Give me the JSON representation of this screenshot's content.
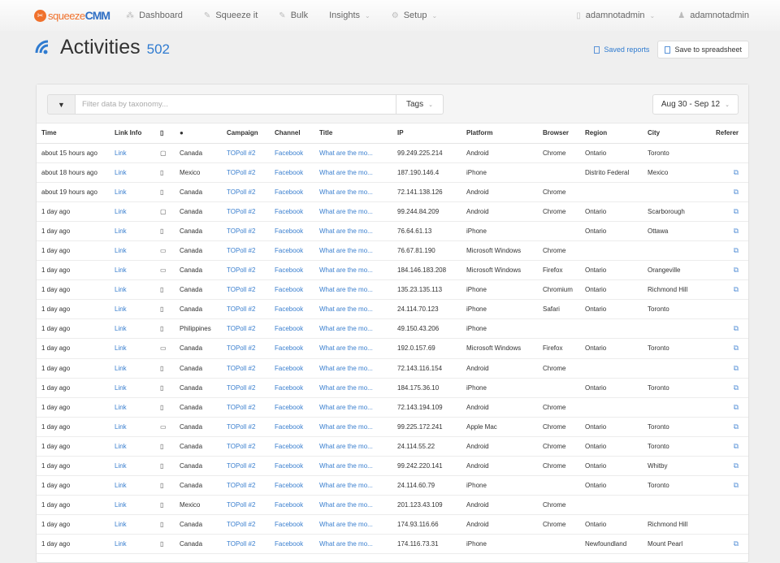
{
  "navbar": {
    "logo": {
      "part1": "squeeze",
      "part2": "CMM"
    },
    "items": [
      {
        "label": "Dashboard",
        "icon": "dashboard-icon"
      },
      {
        "label": "Squeeze it",
        "icon": "pencil-icon"
      },
      {
        "label": "Bulk",
        "icon": "pencil-icon"
      },
      {
        "label": "Insights",
        "dropdown": true
      },
      {
        "label": "Setup",
        "icon": "gear-icon",
        "dropdown": true
      }
    ],
    "account": {
      "label": "adamnotadmin",
      "icon": "building-icon"
    },
    "user": {
      "label": "adamnotadmin",
      "icon": "user-icon"
    }
  },
  "header": {
    "title": "Activities",
    "count": "502",
    "saved_reports": "Saved reports",
    "save_spreadsheet": "Save to spreadsheet"
  },
  "toolbar": {
    "filter_placeholder": "Filter data by taxonomy...",
    "tags_label": "Tags",
    "date_range": "Aug 30 - Sep 12"
  },
  "table": {
    "columns": [
      "Time",
      "Link Info",
      "",
      "",
      "Campaign",
      "Channel",
      "Title",
      "IP",
      "Platform",
      "Browser",
      "Region",
      "City",
      "Referer"
    ],
    "rows": [
      {
        "time": "about 15 hours ago",
        "link": "Link",
        "device": "tablet",
        "country": "Canada",
        "campaign": "TOPoll #2",
        "channel": "Facebook",
        "title": "What are the mo...",
        "ip": "99.249.225.214",
        "platform": "Android",
        "browser": "Chrome",
        "region": "Ontario",
        "city": "Toronto",
        "referer": false
      },
      {
        "time": "about 18 hours ago",
        "link": "Link",
        "device": "phone",
        "country": "Mexico",
        "campaign": "TOPoll #2",
        "channel": "Facebook",
        "title": "What are the mo...",
        "ip": "187.190.146.4",
        "platform": "iPhone",
        "browser": "",
        "region": "Distrito Federal",
        "city": "Mexico",
        "referer": true
      },
      {
        "time": "about 19 hours ago",
        "link": "Link",
        "device": "phone",
        "country": "Canada",
        "campaign": "TOPoll #2",
        "channel": "Facebook",
        "title": "What are the mo...",
        "ip": "72.141.138.126",
        "platform": "Android",
        "browser": "Chrome",
        "region": "",
        "city": "",
        "referer": true
      },
      {
        "time": "1 day ago",
        "link": "Link",
        "device": "tablet",
        "country": "Canada",
        "campaign": "TOPoll #2",
        "channel": "Facebook",
        "title": "What are the mo...",
        "ip": "99.244.84.209",
        "platform": "Android",
        "browser": "Chrome",
        "region": "Ontario",
        "city": "Scarborough",
        "referer": true
      },
      {
        "time": "1 day ago",
        "link": "Link",
        "device": "phone",
        "country": "Canada",
        "campaign": "TOPoll #2",
        "channel": "Facebook",
        "title": "What are the mo...",
        "ip": "76.64.61.13",
        "platform": "iPhone",
        "browser": "",
        "region": "Ontario",
        "city": "Ottawa",
        "referer": true
      },
      {
        "time": "1 day ago",
        "link": "Link",
        "device": "desktop",
        "country": "Canada",
        "campaign": "TOPoll #2",
        "channel": "Facebook",
        "title": "What are the mo...",
        "ip": "76.67.81.190",
        "platform": "Microsoft Windows",
        "browser": "Chrome",
        "region": "",
        "city": "",
        "referer": true
      },
      {
        "time": "1 day ago",
        "link": "Link",
        "device": "desktop",
        "country": "Canada",
        "campaign": "TOPoll #2",
        "channel": "Facebook",
        "title": "What are the mo...",
        "ip": "184.146.183.208",
        "platform": "Microsoft Windows",
        "browser": "Firefox",
        "region": "Ontario",
        "city": "Orangeville",
        "referer": true
      },
      {
        "time": "1 day ago",
        "link": "Link",
        "device": "phone",
        "country": "Canada",
        "campaign": "TOPoll #2",
        "channel": "Facebook",
        "title": "What are the mo...",
        "ip": "135.23.135.113",
        "platform": "iPhone",
        "browser": "Chromium",
        "region": "Ontario",
        "city": "Richmond Hill",
        "referer": true
      },
      {
        "time": "1 day ago",
        "link": "Link",
        "device": "phone",
        "country": "Canada",
        "campaign": "TOPoll #2",
        "channel": "Facebook",
        "title": "What are the mo...",
        "ip": "24.114.70.123",
        "platform": "iPhone",
        "browser": "Safari",
        "region": "Ontario",
        "city": "Toronto",
        "referer": false
      },
      {
        "time": "1 day ago",
        "link": "Link",
        "device": "phone",
        "country": "Philippines",
        "campaign": "TOPoll #2",
        "channel": "Facebook",
        "title": "What are the mo...",
        "ip": "49.150.43.206",
        "platform": "iPhone",
        "browser": "",
        "region": "",
        "city": "",
        "referer": true
      },
      {
        "time": "1 day ago",
        "link": "Link",
        "device": "desktop",
        "country": "Canada",
        "campaign": "TOPoll #2",
        "channel": "Facebook",
        "title": "What are the mo...",
        "ip": "192.0.157.69",
        "platform": "Microsoft Windows",
        "browser": "Firefox",
        "region": "Ontario",
        "city": "Toronto",
        "referer": true
      },
      {
        "time": "1 day ago",
        "link": "Link",
        "device": "phone",
        "country": "Canada",
        "campaign": "TOPoll #2",
        "channel": "Facebook",
        "title": "What are the mo...",
        "ip": "72.143.116.154",
        "platform": "Android",
        "browser": "Chrome",
        "region": "",
        "city": "",
        "referer": true
      },
      {
        "time": "1 day ago",
        "link": "Link",
        "device": "phone",
        "country": "Canada",
        "campaign": "TOPoll #2",
        "channel": "Facebook",
        "title": "What are the mo...",
        "ip": "184.175.36.10",
        "platform": "iPhone",
        "browser": "",
        "region": "Ontario",
        "city": "Toronto",
        "referer": true
      },
      {
        "time": "1 day ago",
        "link": "Link",
        "device": "phone",
        "country": "Canada",
        "campaign": "TOPoll #2",
        "channel": "Facebook",
        "title": "What are the mo...",
        "ip": "72.143.194.109",
        "platform": "Android",
        "browser": "Chrome",
        "region": "",
        "city": "",
        "referer": true
      },
      {
        "time": "1 day ago",
        "link": "Link",
        "device": "desktop",
        "country": "Canada",
        "campaign": "TOPoll #2",
        "channel": "Facebook",
        "title": "What are the mo...",
        "ip": "99.225.172.241",
        "platform": "Apple Mac",
        "browser": "Chrome",
        "region": "Ontario",
        "city": "Toronto",
        "referer": true
      },
      {
        "time": "1 day ago",
        "link": "Link",
        "device": "phone",
        "country": "Canada",
        "campaign": "TOPoll #2",
        "channel": "Facebook",
        "title": "What are the mo...",
        "ip": "24.114.55.22",
        "platform": "Android",
        "browser": "Chrome",
        "region": "Ontario",
        "city": "Toronto",
        "referer": true
      },
      {
        "time": "1 day ago",
        "link": "Link",
        "device": "phone",
        "country": "Canada",
        "campaign": "TOPoll #2",
        "channel": "Facebook",
        "title": "What are the mo...",
        "ip": "99.242.220.141",
        "platform": "Android",
        "browser": "Chrome",
        "region": "Ontario",
        "city": "Whitby",
        "referer": true
      },
      {
        "time": "1 day ago",
        "link": "Link",
        "device": "phone",
        "country": "Canada",
        "campaign": "TOPoll #2",
        "channel": "Facebook",
        "title": "What are the mo...",
        "ip": "24.114.60.79",
        "platform": "iPhone",
        "browser": "",
        "region": "Ontario",
        "city": "Toronto",
        "referer": true
      },
      {
        "time": "1 day ago",
        "link": "Link",
        "device": "phone",
        "country": "Mexico",
        "campaign": "TOPoll #2",
        "channel": "Facebook",
        "title": "What are the mo...",
        "ip": "201.123.43.109",
        "platform": "Android",
        "browser": "Chrome",
        "region": "",
        "city": "",
        "referer": false
      },
      {
        "time": "1 day ago",
        "link": "Link",
        "device": "phone",
        "country": "Canada",
        "campaign": "TOPoll #2",
        "channel": "Facebook",
        "title": "What are the mo...",
        "ip": "174.93.116.66",
        "platform": "Android",
        "browser": "Chrome",
        "region": "Ontario",
        "city": "Richmond Hill",
        "referer": false
      },
      {
        "time": "1 day ago",
        "link": "Link",
        "device": "phone",
        "country": "Canada",
        "campaign": "TOPoll #2",
        "channel": "Facebook",
        "title": "What are the mo...",
        "ip": "174.116.73.31",
        "platform": "iPhone",
        "browser": "",
        "region": "Newfoundland",
        "city": "Mount Pearl",
        "referer": true
      }
    ]
  }
}
